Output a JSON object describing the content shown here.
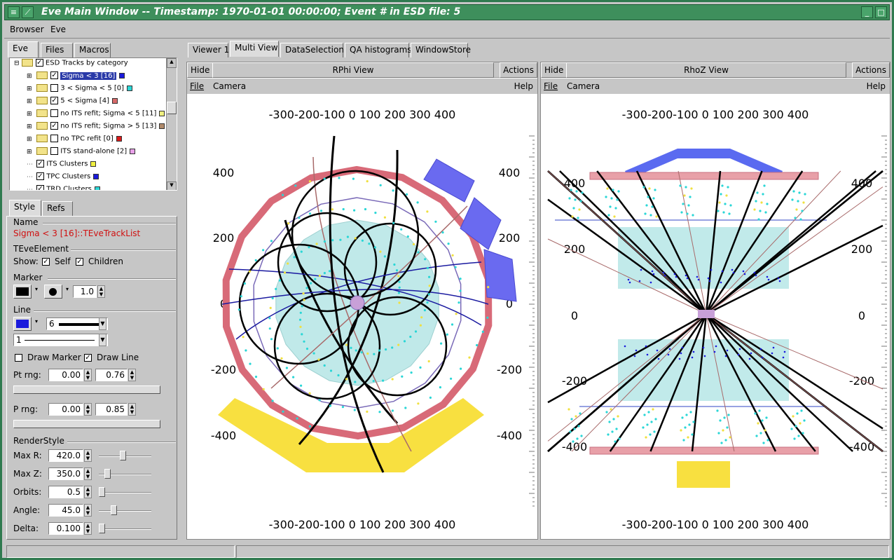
{
  "window": {
    "title": "Eve Main Window -- Timestamp: 1970-01-01 00:00:00; Event # in ESD file: 5"
  },
  "menubar": [
    {
      "label": "Browser"
    },
    {
      "label": "Eve"
    }
  ],
  "left_tabs": [
    "Eve",
    "Files",
    "Macros"
  ],
  "tree": {
    "root": "ESD Tracks by category",
    "items": [
      {
        "label": "Sigma < 3 [16]",
        "checked": true,
        "color": "#1a1adc",
        "selected": true
      },
      {
        "label": "3 < Sigma < 5 [0]",
        "checked": false,
        "color": "#2ad6d6"
      },
      {
        "label": "5 < Sigma [4]",
        "checked": true,
        "color": "#d86a6a"
      },
      {
        "label": "no ITS refit; Sigma < 5 [11]",
        "checked": false,
        "color": "#f0f080"
      },
      {
        "label": "no ITS refit; Sigma > 5 [13]",
        "checked": true,
        "color": "#b08a6a"
      },
      {
        "label": "no TPC refit [0]",
        "checked": false,
        "color": "#dc1a1a"
      },
      {
        "label": "ITS stand-alone [2]",
        "checked": false,
        "color": "#e8a0e8"
      }
    ],
    "clusters": [
      {
        "label": "ITS Clusters",
        "checked": true,
        "color": "#f0f040"
      },
      {
        "label": "TPC Clusters",
        "checked": true,
        "color": "#1a1adc"
      },
      {
        "label": "TRD Clusters",
        "checked": true,
        "color": "#2ad6d6"
      }
    ]
  },
  "editor": {
    "tabs": [
      "Style",
      "Refs"
    ],
    "name_label": "Name",
    "name_value": "Sigma < 3 [16]::TEveTrackList",
    "element_label": "TEveElement",
    "show_label": "Show:",
    "self_label": "Self",
    "children_label": "Children",
    "marker_label": "Marker",
    "marker_size": "1.0",
    "line_label": "Line",
    "line_width": "6",
    "line_style": "1",
    "draw_marker_label": "Draw Marker",
    "draw_line_label": "Draw Line",
    "pt_label": "Pt rng:",
    "pt_min": "0.00",
    "pt_max": "0.76",
    "p_label": "P rng:",
    "p_min": "0.00",
    "p_max": "0.85",
    "render_label": "RenderStyle",
    "max_r_label": "Max R:",
    "max_r": "420.0",
    "max_z_label": "Max Z:",
    "max_z": "350.0",
    "orbits_label": "Orbits:",
    "orbits": "0.5",
    "angle_label": "Angle:",
    "angle": "45.0",
    "delta_label": "Delta:",
    "delta": "0.100"
  },
  "main_tabs": [
    "Viewer 1",
    "Multi View",
    "DataSelection",
    "QA histograms",
    "WindowStore"
  ],
  "viewers": [
    {
      "hide": "Hide",
      "title": "RPhi View",
      "actions": "Actions",
      "file": "File",
      "camera": "Camera",
      "help": "Help",
      "top_ticks": "-300-200-100    0  100  200  300  400",
      "bottom_ticks": "-300-200-100    0  100  200  300  400",
      "left_ticks": [
        "400",
        "200",
        "0",
        "-200",
        "-400"
      ],
      "right_ticks": [
        "400",
        "200",
        "0",
        "-200",
        "-400"
      ]
    },
    {
      "hide": "Hide",
      "title": "RhoZ View",
      "actions": "Actions",
      "file": "File",
      "camera": "Camera",
      "help": "Help",
      "top_ticks": "-300-200-100    0  100  200  300  400",
      "bottom_ticks": "-300-200-100    0  100  200  300  400",
      "left_ticks": [
        "400",
        "200",
        "0",
        "-200",
        "-400"
      ],
      "right_ticks": [
        "400",
        "200",
        "0",
        "-200",
        "-400"
      ]
    }
  ]
}
